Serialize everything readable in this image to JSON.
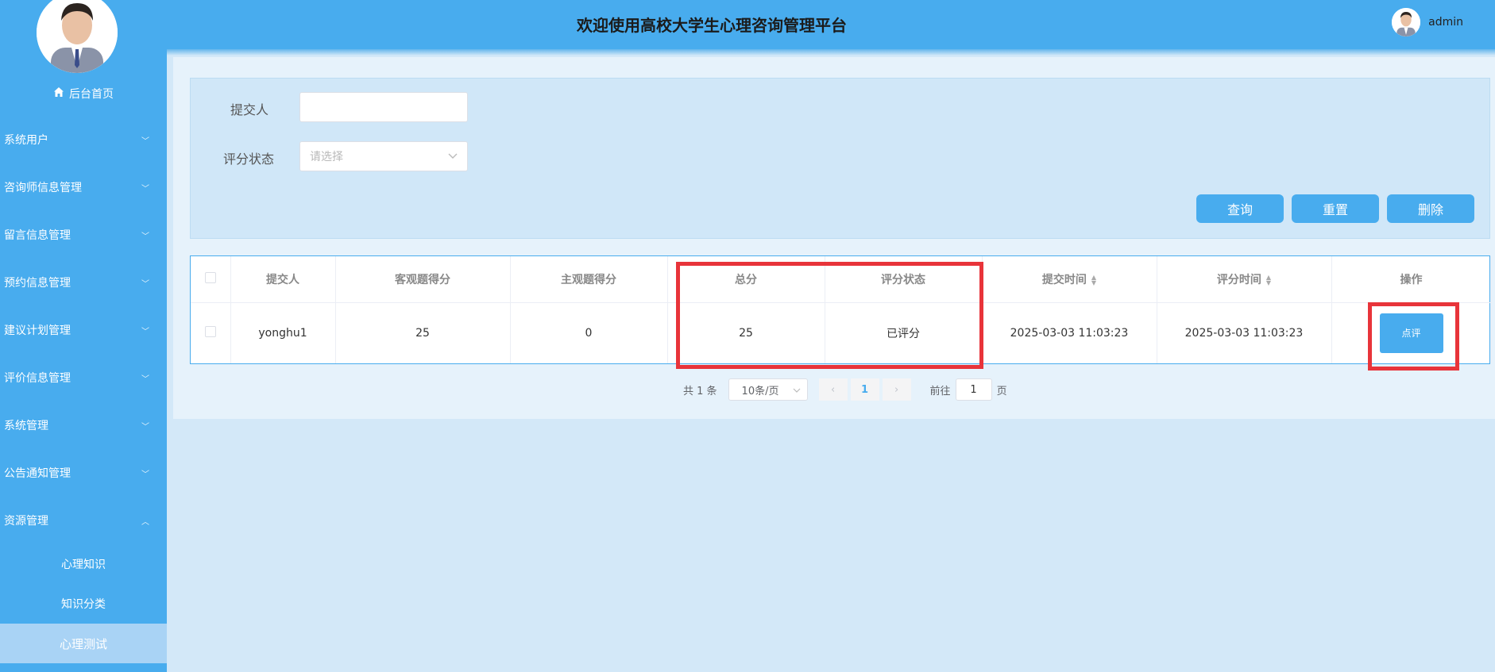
{
  "header": {
    "title": "欢迎使用高校大学生心理咨询管理平台",
    "username": "admin"
  },
  "sidebar": {
    "home": "后台首页",
    "items": [
      {
        "label": "系统用户",
        "expanded": false
      },
      {
        "label": "咨询师信息管理",
        "expanded": false
      },
      {
        "label": "留言信息管理",
        "expanded": false
      },
      {
        "label": "预约信息管理",
        "expanded": false
      },
      {
        "label": "建议计划管理",
        "expanded": false
      },
      {
        "label": "评价信息管理",
        "expanded": false
      },
      {
        "label": "系统管理",
        "expanded": false
      },
      {
        "label": "公告通知管理",
        "expanded": false
      },
      {
        "label": "资源管理",
        "expanded": true
      }
    ],
    "sub_items": [
      {
        "label": "心理知识",
        "active": false
      },
      {
        "label": "知识分类",
        "active": false
      },
      {
        "label": "心理测试",
        "active": true
      }
    ]
  },
  "search": {
    "submitter_label": "提交人",
    "submitter_value": "",
    "status_label": "评分状态",
    "status_placeholder": "请选择",
    "query_button": "查询",
    "reset_button": "重置",
    "delete_button": "删除"
  },
  "table": {
    "columns": [
      "提交人",
      "客观题得分",
      "主观题得分",
      "总分",
      "评分状态",
      "提交时间",
      "评分时间",
      "操作"
    ],
    "rows": [
      {
        "submitter": "yonghu1",
        "objective": "25",
        "subjective": "0",
        "total": "25",
        "status": "已评分",
        "submit_time": "2025-03-03 11:03:23",
        "review_time": "2025-03-03 11:03:23",
        "action": "点评"
      }
    ]
  },
  "pagination": {
    "total": "共 1 条",
    "page_size": "10条/页",
    "current_page": "1",
    "goto_prefix": "前往",
    "goto_value": "1",
    "goto_suffix": "页"
  },
  "colors": {
    "accent": "#48acee",
    "highlight": "#e8343a",
    "background": "#d3e8f8"
  }
}
